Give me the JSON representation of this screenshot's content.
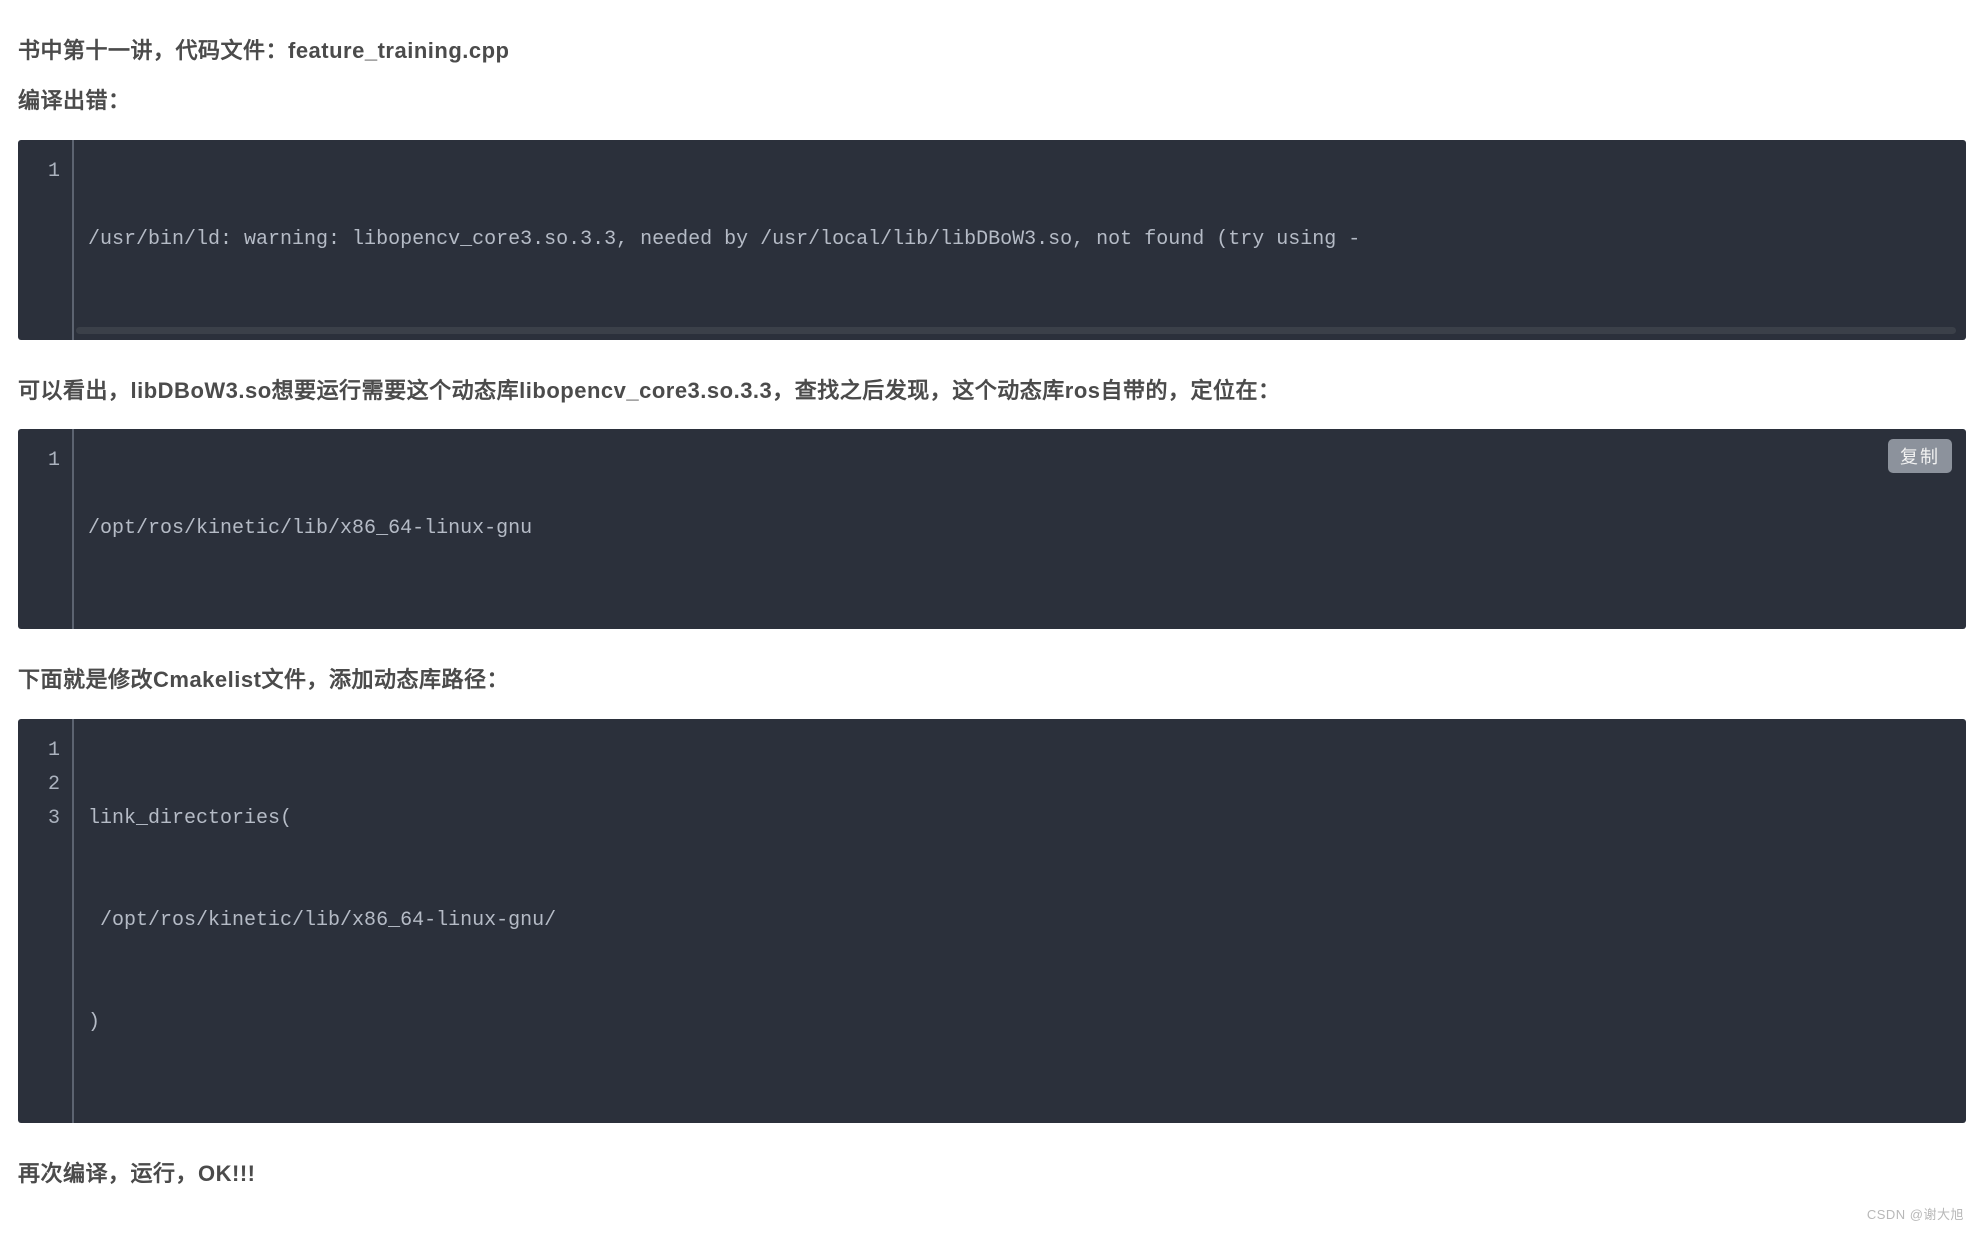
{
  "intro": {
    "line1": "书中第十一讲，代码文件：feature_training.cpp",
    "line2": "编译出错："
  },
  "code1": {
    "lines": [
      "/usr/bin/ld: warning: libopencv_core3.so.3.3, needed by /usr/local/lib/libDBoW3.so, not found (try using -"
    ]
  },
  "para2": "可以看出，libDBoW3.so想要运行需要这个动态库libopencv_core3.so.3.3，查找之后发现，这个动态库ros自带的，定位在：",
  "code2": {
    "lines": [
      "/opt/ros/kinetic/lib/x86_64-linux-gnu"
    ],
    "copy_label": "复制"
  },
  "para3": "下面就是修改Cmakelist文件，添加动态库路径：",
  "code3": {
    "lines": [
      "link_directories(",
      " /opt/ros/kinetic/lib/x86_64-linux-gnu/",
      ")"
    ]
  },
  "para4": "再次编译，运行，OK!!!",
  "watermark": "CSDN @谢大旭"
}
